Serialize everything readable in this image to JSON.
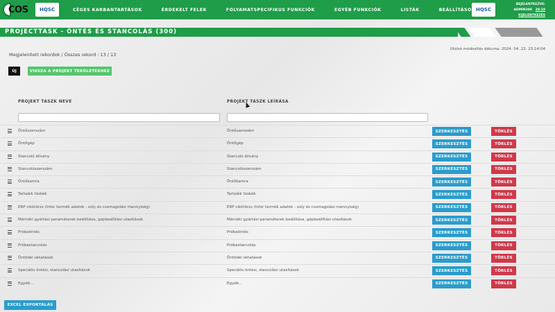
{
  "nav": {
    "logo_text": "COS",
    "hqsc_text": "HQSC",
    "items": [
      {
        "label": "CÉGES KARBANTARTÁSOK"
      },
      {
        "label": "ÉRDEKELT FELEK"
      },
      {
        "label": "FOLYAMATSPECIFIKUS FUNKCIÓK"
      },
      {
        "label": "EGYÉB FUNKCIÓK"
      },
      {
        "label": "LISTÁK"
      },
      {
        "label": "BEÁLLÍTÁSOK"
      }
    ],
    "user": {
      "logged_in_label": "BEJELENTKEZVE:",
      "username": "ADMIN300",
      "session_time": "29:19",
      "logout_label": "KIJELENTKEZÉS"
    }
  },
  "page": {
    "title": "PROJECTTASK - ÖNTÉS ÉS STANCOLÁS (300)",
    "records_text": "Megjelenített rekordok / Összes rekord : 13 / 13",
    "last_modified": "Utolsó módosítás dátuma: 2024. 04. 22. 23:14:04",
    "new_button": "ÚJ",
    "back_button": "VISSZA A PROJEKT TERÜLETEKHEZ",
    "export_button": "EXCEL EXPORTÁLÁS"
  },
  "table": {
    "col_name": "PROJEKT TASZK NEVE",
    "col_desc": "PROJEKT TASZK LEÍRÁSA",
    "edit_label": "SZERKESZTÉS",
    "delete_label": "TÖRLÉS",
    "rows": [
      {
        "name": "Öntőszerszám",
        "desc": "Öntőszerszám"
      },
      {
        "name": "Öntőgép",
        "desc": "Öntőgép"
      },
      {
        "name": "Stancoló állvány",
        "desc": "Stancoló állvány"
      },
      {
        "name": "Stancolószerszám",
        "desc": "Stancolószerszám"
      },
      {
        "name": "Öntőkamra",
        "desc": "Öntőkamra"
      },
      {
        "name": "Tartalék tüskék",
        "desc": "Tartalék tüskék"
      },
      {
        "name": "ERP cikktörzs (Infor termék adatok - súly és csomagolási mennyiség)",
        "desc": "ERP cikktörzs (Infor termék adatok - súly és csomagolási mennyiség)"
      },
      {
        "name": "Mérnöki gyártási paraméterek beállítása, gépbeállítási utasítások",
        "desc": "Mérnöki gyártási paraméterek beállítása, gépbeállítási utasítások"
      },
      {
        "name": "Próbaöntés",
        "desc": "Próbaöntés"
      },
      {
        "name": "Próbastancolás",
        "desc": "Próbastancolás"
      },
      {
        "name": "Öntödei oktatások",
        "desc": "Öntödei oktatások"
      },
      {
        "name": "Speciális öntési, stancolási utasítások",
        "desc": "Speciális öntési, stancolási utasítások"
      },
      {
        "name": "Egyéb...",
        "desc": "Egyéb..."
      }
    ]
  }
}
